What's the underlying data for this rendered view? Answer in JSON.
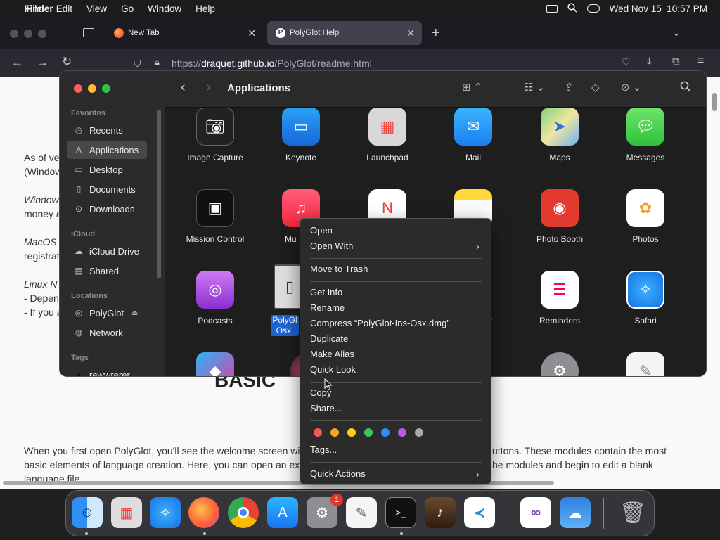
{
  "menubar": {
    "app_name": "Finder",
    "menus": [
      "File",
      "Edit",
      "View",
      "Go",
      "Window",
      "Help"
    ],
    "datetime": "Wed Nov 15  10:57 PM"
  },
  "browser": {
    "tabs": [
      {
        "label": "New Tab",
        "active": false
      },
      {
        "label": "PolyGlot Help",
        "active": true
      }
    ],
    "url_prefix": "https://",
    "url_domain": "draquet.github.io",
    "url_path": "/PolyGlot/readme.html",
    "page_text": {
      "p1": "As of ve",
      "p1b": "(Window",
      "p2": "Window",
      "p2b": "money a",
      "p3": "MacOS",
      "p3b": "registrat",
      "p4": "Linux N",
      "p4b": "- Depen",
      "p4c": "- If you a",
      "heading": "BASIC",
      "bottom1": "When you first open PolyGlot, you'll see the welcome screen wi",
      "bottom1r": "uttons. These modules contain the most",
      "bottom2": "basic elements of language creation. Here, you can open an ex",
      "bottom2r": "he modules and begin to edit a blank",
      "bottom3": "language file."
    }
  },
  "finder": {
    "title": "Applications",
    "sidebar": {
      "favorites_header": "Favorites",
      "favorites": [
        "Recents",
        "Applications",
        "Desktop",
        "Documents",
        "Downloads"
      ],
      "icloud_header": "iCloud",
      "icloud": [
        "iCloud Drive",
        "Shared"
      ],
      "locations_header": "Locations",
      "locations": [
        "PolyGlot",
        "Network"
      ],
      "tags_header": "Tags",
      "tags": [
        "rewwrerer"
      ]
    },
    "apps_row1": [
      "Image Capture",
      "Keynote",
      "Launchpad",
      "Mail",
      "Maps",
      "Messages"
    ],
    "apps_row2": [
      "Mission Control",
      "Mu",
      "",
      "",
      "Photo Booth",
      "Photos"
    ],
    "apps_row3": [
      "Podcasts",
      "PolyGl Osx.",
      "",
      "ayer",
      "Reminders",
      "Safari"
    ],
    "selected_file_line1": "PolyGl",
    "selected_file_line2": "Osx."
  },
  "context_menu": {
    "items": {
      "open": "Open",
      "open_with": "Open With",
      "move_to_trash": "Move to Trash",
      "get_info": "Get Info",
      "rename": "Rename",
      "compress": "Compress “PolyGlot-Ins-Osx.dmg”",
      "duplicate": "Duplicate",
      "make_alias": "Make Alias",
      "quick_look": "Quick Look",
      "copy": "Copy",
      "share": "Share...",
      "tags": "Tags...",
      "quick_actions": "Quick Actions"
    },
    "tag_colors": [
      "#ec5b56",
      "#f5a623",
      "#f5d020",
      "#3cc55b",
      "#2f8ff0",
      "#b45ce0",
      "#a8a8a8"
    ]
  },
  "dock": {
    "apps": [
      "Finder",
      "Launchpad",
      "Safari",
      "Firefox",
      "Chrome",
      "App Store",
      "System Settings",
      "TextEdit",
      "Terminal",
      "Instruments",
      "VS Code",
      "Visual Studio",
      "Weather",
      "Trash"
    ],
    "settings_badge": "1"
  }
}
